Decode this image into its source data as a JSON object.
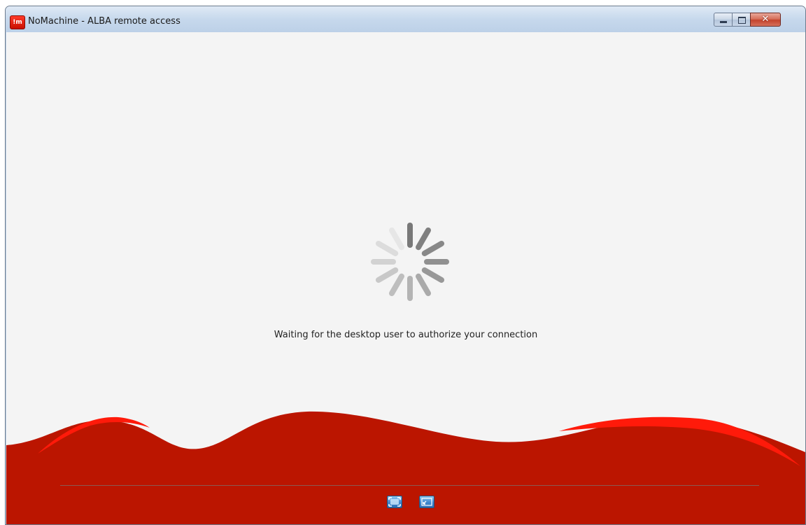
{
  "window": {
    "title": "NoMachine - ALBA remote access",
    "app_icon_text": "!m",
    "close_glyph": "✕"
  },
  "main": {
    "status_message": "Waiting for the desktop user to authorize your connection",
    "spinner_icon": "loading-spinner-icon"
  },
  "footer": {
    "controls": [
      {
        "icon": "fullscreen-icon"
      },
      {
        "icon": "window-mode-icon"
      }
    ]
  },
  "colors": {
    "accent_red": "#bb1500",
    "highlight_red": "#ff1a0a",
    "background": "#f4f4f4"
  }
}
